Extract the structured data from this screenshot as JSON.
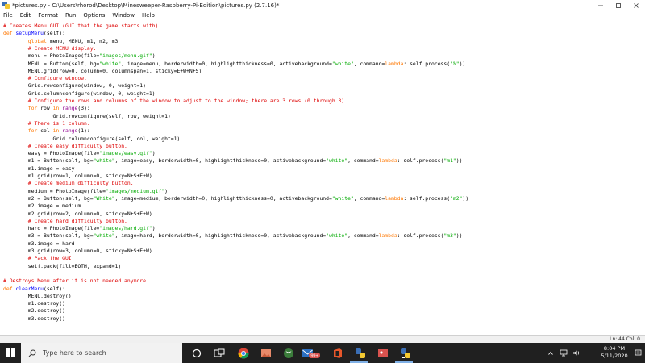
{
  "window": {
    "title": "*pictures.py - C:\\Users\\rhorod\\Desktop\\Minesweeper-Raspberry-Pi-Edition\\pictures.py (2.7.16)*"
  },
  "menu": {
    "items": [
      "File",
      "Edit",
      "Format",
      "Run",
      "Options",
      "Window",
      "Help"
    ]
  },
  "editor": {
    "lines": [
      [
        {
          "t": "# Creates Menu GUI (GUI that the game starts with).",
          "c": "comment"
        }
      ],
      [
        {
          "t": "def ",
          "c": "kw"
        },
        {
          "t": "setupMenu",
          "c": "def"
        },
        {
          "t": "(self):",
          "c": "plain"
        }
      ],
      [
        {
          "t": "        ",
          "c": "plain"
        },
        {
          "t": "global",
          "c": "kw"
        },
        {
          "t": " menu, MENU, m1, m2, m3",
          "c": "plain"
        }
      ],
      [
        {
          "t": "        # Create MENU display.",
          "c": "comment"
        }
      ],
      [
        {
          "t": "        menu = PhotoImage(file=",
          "c": "plain"
        },
        {
          "t": "\"images/menu.gif\"",
          "c": "str"
        },
        {
          "t": ")",
          "c": "plain"
        }
      ],
      [
        {
          "t": "        MENU = Button(self, bg=",
          "c": "plain"
        },
        {
          "t": "\"white\"",
          "c": "str"
        },
        {
          "t": ", image=menu, borderwidth=0, highlightthickness=0, activebackground=",
          "c": "plain"
        },
        {
          "t": "\"white\"",
          "c": "str"
        },
        {
          "t": ", command=",
          "c": "plain"
        },
        {
          "t": "lambda",
          "c": "kw"
        },
        {
          "t": ": self.process(",
          "c": "plain"
        },
        {
          "t": "\"%\"",
          "c": "str"
        },
        {
          "t": "))",
          "c": "plain"
        }
      ],
      [
        {
          "t": "        MENU.grid(row=0, column=0, columnspan=1, sticky=E+W+N+S)",
          "c": "plain"
        }
      ],
      [
        {
          "t": "        # Configure window.",
          "c": "comment"
        }
      ],
      [
        {
          "t": "        Grid.rowconfigure(window, 0, weight=1)",
          "c": "plain"
        }
      ],
      [
        {
          "t": "        Grid.columnconfigure(window, 0, weight=1)",
          "c": "plain"
        }
      ],
      [
        {
          "t": "        # Configure the rows and columns of the window to adjust to the window; there are 3 rows (0 through 3).",
          "c": "comment"
        }
      ],
      [
        {
          "t": "        ",
          "c": "plain"
        },
        {
          "t": "for",
          "c": "kw"
        },
        {
          "t": " row ",
          "c": "plain"
        },
        {
          "t": "in",
          "c": "kw"
        },
        {
          "t": " ",
          "c": "plain"
        },
        {
          "t": "range",
          "c": "builtin"
        },
        {
          "t": "(3):",
          "c": "plain"
        }
      ],
      [
        {
          "t": "                Grid.rowconfigure(self, row, weight=1)",
          "c": "plain"
        }
      ],
      [
        {
          "t": "        # There is 1 column.",
          "c": "comment"
        }
      ],
      [
        {
          "t": "        ",
          "c": "plain"
        },
        {
          "t": "for",
          "c": "kw"
        },
        {
          "t": " col ",
          "c": "plain"
        },
        {
          "t": "in",
          "c": "kw"
        },
        {
          "t": " ",
          "c": "plain"
        },
        {
          "t": "range",
          "c": "builtin"
        },
        {
          "t": "(1):",
          "c": "plain"
        }
      ],
      [
        {
          "t": "                Grid.columnconfigure(self, col, weight=1)",
          "c": "plain"
        }
      ],
      [
        {
          "t": "        # Create easy difficulty button.",
          "c": "comment"
        }
      ],
      [
        {
          "t": "        easy = PhotoImage(file=",
          "c": "plain"
        },
        {
          "t": "\"images/easy.gif\"",
          "c": "str"
        },
        {
          "t": ")",
          "c": "plain"
        }
      ],
      [
        {
          "t": "        m1 = Button(self, bg=",
          "c": "plain"
        },
        {
          "t": "\"white\"",
          "c": "str"
        },
        {
          "t": ", image=easy, borderwidth=0, highlightthickness=0, activebackground=",
          "c": "plain"
        },
        {
          "t": "\"white\"",
          "c": "str"
        },
        {
          "t": ", command=",
          "c": "plain"
        },
        {
          "t": "lambda",
          "c": "kw"
        },
        {
          "t": ": self.process(",
          "c": "plain"
        },
        {
          "t": "\"m1\"",
          "c": "str"
        },
        {
          "t": "))",
          "c": "plain"
        }
      ],
      [
        {
          "t": "        m1.image = easy",
          "c": "plain"
        }
      ],
      [
        {
          "t": "        m1.grid(row=1, column=0, sticky=N+S+E+W)",
          "c": "plain"
        }
      ],
      [
        {
          "t": "        # Create medium difficulty button.",
          "c": "comment"
        }
      ],
      [
        {
          "t": "        medium = PhotoImage(file=",
          "c": "plain"
        },
        {
          "t": "\"images/medium.gif\"",
          "c": "str"
        },
        {
          "t": ")",
          "c": "plain"
        }
      ],
      [
        {
          "t": "        m2 = Button(self, bg=",
          "c": "plain"
        },
        {
          "t": "\"White\"",
          "c": "str"
        },
        {
          "t": ", image=medium, borderwidth=0, highlightthickness=0, activebackground=",
          "c": "plain"
        },
        {
          "t": "\"white\"",
          "c": "str"
        },
        {
          "t": ", command=",
          "c": "plain"
        },
        {
          "t": "lambda",
          "c": "kw"
        },
        {
          "t": ": self.process(",
          "c": "plain"
        },
        {
          "t": "\"m2\"",
          "c": "str"
        },
        {
          "t": "))",
          "c": "plain"
        }
      ],
      [
        {
          "t": "        m2.image = medium",
          "c": "plain"
        }
      ],
      [
        {
          "t": "        m2.grid(row=2, column=0, sticky=N+S+E+W)",
          "c": "plain"
        }
      ],
      [
        {
          "t": "        # Create hard difficulty button.",
          "c": "comment"
        }
      ],
      [
        {
          "t": "        hard = PhotoImage(file=",
          "c": "plain"
        },
        {
          "t": "\"images/hard.gif\"",
          "c": "str"
        },
        {
          "t": ")",
          "c": "plain"
        }
      ],
      [
        {
          "t": "        m3 = Button(self, bg=",
          "c": "plain"
        },
        {
          "t": "\"white\"",
          "c": "str"
        },
        {
          "t": ", image=hard, borderwidth=0, highlightthickness=0, activebackground=",
          "c": "plain"
        },
        {
          "t": "\"white\"",
          "c": "str"
        },
        {
          "t": ", command=",
          "c": "plain"
        },
        {
          "t": "lambda",
          "c": "kw"
        },
        {
          "t": ": self.process(",
          "c": "plain"
        },
        {
          "t": "\"m3\"",
          "c": "str"
        },
        {
          "t": "))",
          "c": "plain"
        }
      ],
      [
        {
          "t": "        m3.image = hard",
          "c": "plain"
        }
      ],
      [
        {
          "t": "        m3.grid(row=3, column=0, sticky=N+S+E+W)",
          "c": "plain"
        }
      ],
      [
        {
          "t": "        # Pack the GUI.",
          "c": "comment"
        }
      ],
      [
        {
          "t": "        self.pack(fill=BOTH, expand=1)",
          "c": "plain"
        }
      ],
      [
        {
          "t": "",
          "c": "plain"
        }
      ],
      [
        {
          "t": "# Destroys Menu after it is not needed anymore.",
          "c": "comment"
        }
      ],
      [
        {
          "t": "def ",
          "c": "kw"
        },
        {
          "t": "clearMenu",
          "c": "def"
        },
        {
          "t": "(self):",
          "c": "plain"
        }
      ],
      [
        {
          "t": "        MENU.destroy()",
          "c": "plain"
        }
      ],
      [
        {
          "t": "        m1.destroy()",
          "c": "plain"
        }
      ],
      [
        {
          "t": "        m2.destroy()",
          "c": "plain"
        }
      ],
      [
        {
          "t": "        m3.destroy()",
          "c": "plain"
        }
      ]
    ]
  },
  "status": {
    "text": "Ln: 44   Col: 0"
  },
  "taskbar": {
    "search_placeholder": "Type here to search",
    "badge": "99+",
    "time": "8:04 PM",
    "date": "5/11/2020",
    "icons": [
      "task-view-icon",
      "chrome-icon",
      "photos-icon",
      "xbox-icon",
      "store-icon",
      "mail-icon",
      "office-icon",
      "python-icon",
      "pictures-icon",
      "idle-icon"
    ]
  },
  "colors": {
    "comment": "#dd0000",
    "keyword": "#ff7700",
    "defname": "#0000ff",
    "string": "#00aa00",
    "builtin": "#900090",
    "taskbar": "#202020"
  }
}
